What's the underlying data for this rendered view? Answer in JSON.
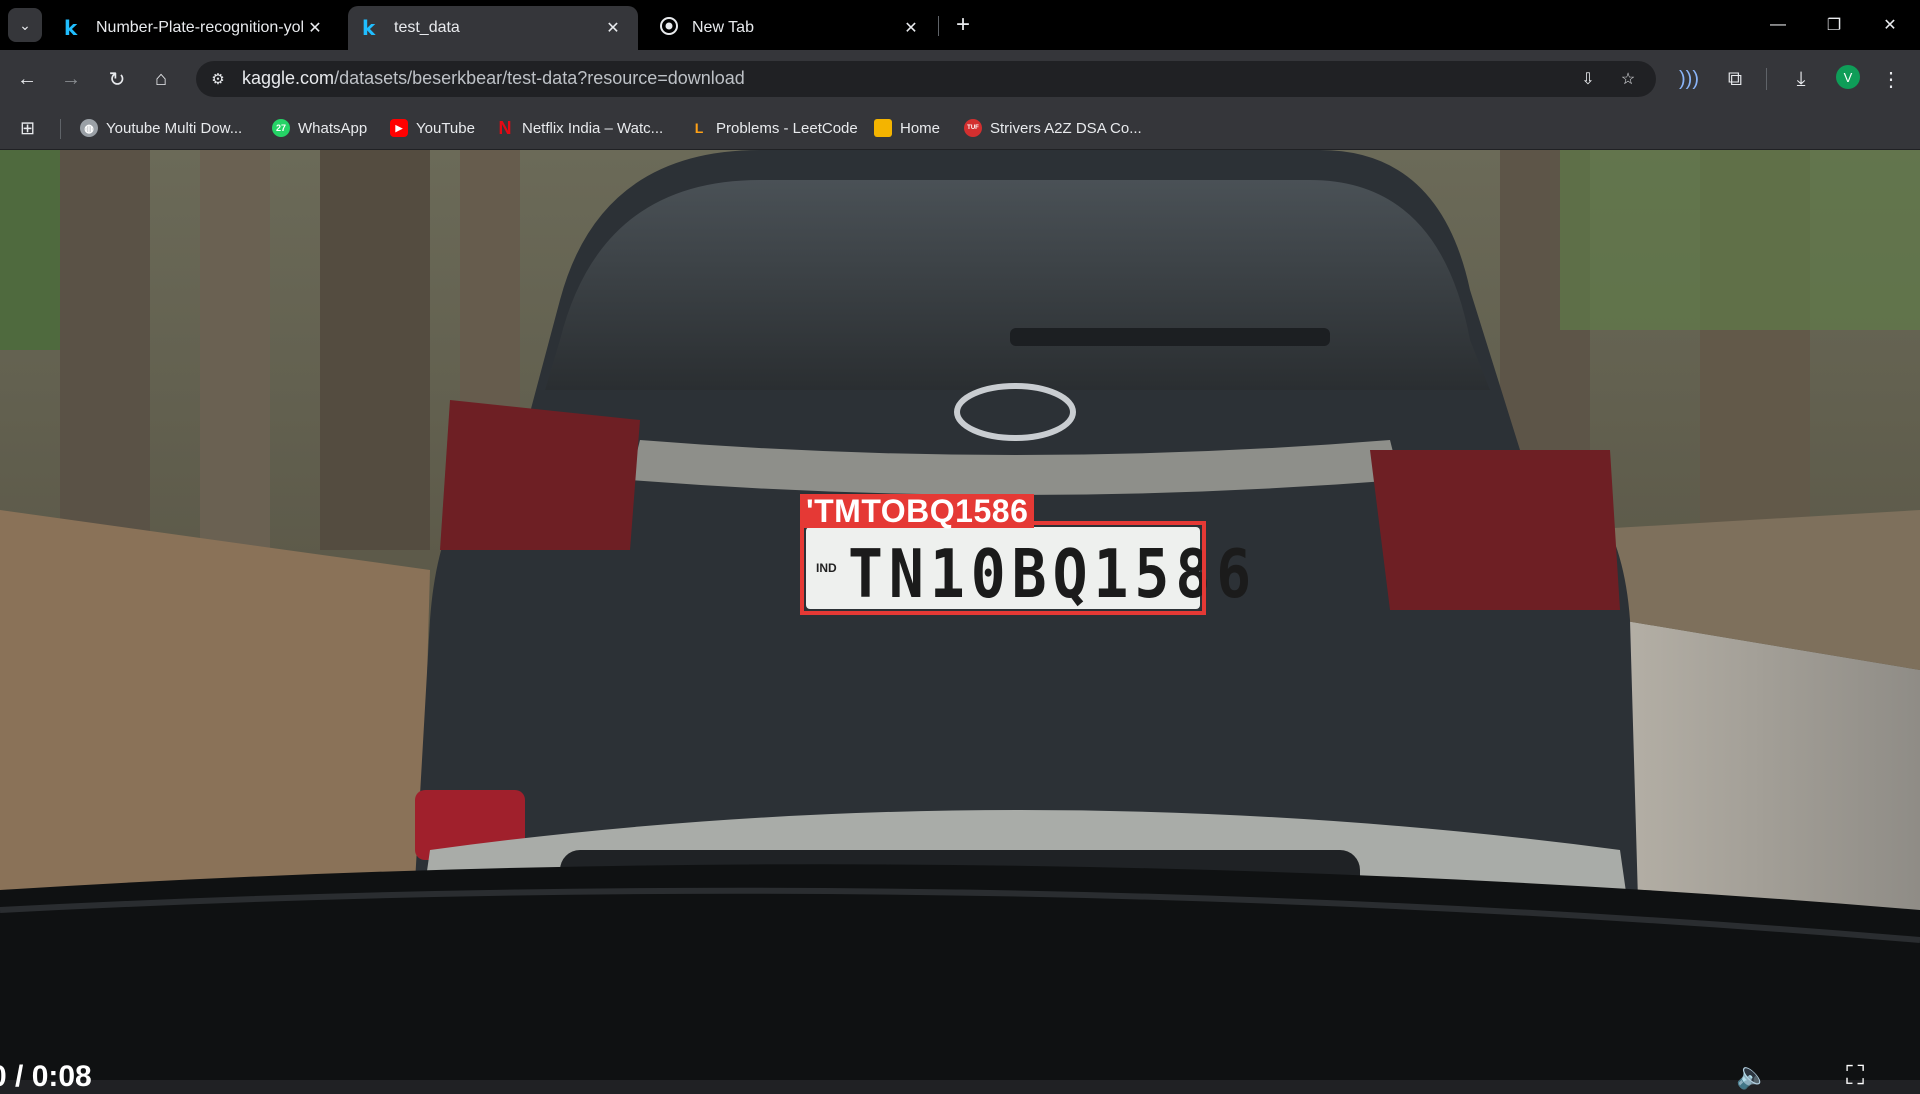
{
  "tabs": [
    {
      "icon": "kaggle-icon",
      "favicon_text": "k",
      "title": "Number-Plate-recognition-yolo",
      "active": false
    },
    {
      "icon": "kaggle-icon",
      "favicon_text": "k",
      "title": "test_data",
      "active": true
    },
    {
      "icon": "chrome-icon",
      "favicon_text": "",
      "title": "New Tab",
      "active": false
    }
  ],
  "toolbar": {
    "url_host": "kaggle.com",
    "url_path": "/datasets/beserkbear/test-data?resource=download",
    "avatar_letter": "V"
  },
  "bookmarks": [
    {
      "label": "Youtube Multi Dow...",
      "icon": "globe-icon",
      "color": "#9aa0a6",
      "glyph": ""
    },
    {
      "label": "WhatsApp",
      "icon": "whatsapp-icon",
      "color": "#25d366",
      "glyph": "27"
    },
    {
      "label": "YouTube",
      "icon": "youtube-icon",
      "color": "#ff0000",
      "glyph": "▶"
    },
    {
      "label": "Netflix India – Watc...",
      "icon": "netflix-icon",
      "color": "#e50914",
      "glyph": "N"
    },
    {
      "label": "Problems - LeetCode",
      "icon": "leetcode-icon",
      "color": "#ffa116",
      "glyph": "L"
    },
    {
      "label": "Home",
      "icon": "home-image-icon",
      "color": "#f4b400",
      "glyph": ""
    },
    {
      "label": "Strivers A2Z DSA Co...",
      "icon": "tuf-icon",
      "color": "#d32f2f",
      "glyph": "TUF"
    }
  ],
  "viewer": {
    "detected_text": "'TMTOBQ1586",
    "plate_prefix": "IND",
    "plate_number": "TN10BQ1586",
    "time_display": "0 / 0:08",
    "accent": "#e53935"
  }
}
